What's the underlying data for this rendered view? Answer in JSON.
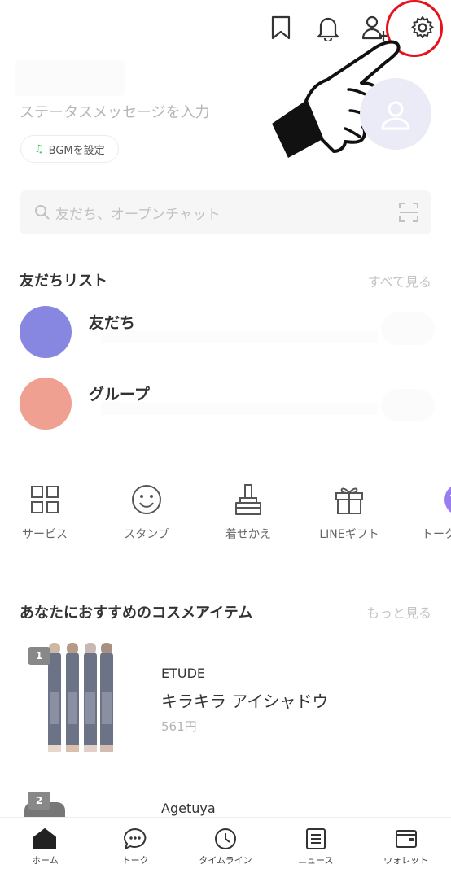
{
  "header": {
    "icons": [
      "bookmark-icon",
      "bell-icon",
      "add-friend-icon",
      "gear-icon"
    ],
    "highlight_color": "#e8101a"
  },
  "profile": {
    "status_placeholder": "ステータスメッセージを入力",
    "bgm_label": "BGMを設定"
  },
  "search": {
    "placeholder": "友だち、オープンチャット"
  },
  "friends_section": {
    "title": "友だちリスト",
    "link": "すべて見る",
    "rows": [
      {
        "label": "友だち",
        "color": "#8786e0"
      },
      {
        "label": "グループ",
        "color": "#f0a090"
      }
    ]
  },
  "services": [
    {
      "label": "サービス",
      "icon": "grid-icon"
    },
    {
      "label": "スタンプ",
      "icon": "smile-icon"
    },
    {
      "label": "着せかえ",
      "icon": "brush-icon"
    },
    {
      "label": "LINEギフト",
      "icon": "gift-icon"
    },
    {
      "label": "トーク",
      "icon": "talk-icon"
    }
  ],
  "recommend_section": {
    "title": "あなたにおすすめのコスメアイテム",
    "link": "もっと見る",
    "items": [
      {
        "rank": "1",
        "brand": "ETUDE",
        "name": "キラキラ アイシャドウ",
        "price": "561円"
      },
      {
        "rank": "2",
        "brand": "Agetuya",
        "name": "",
        "price": ""
      }
    ]
  },
  "bottom_nav": [
    {
      "label": "ホーム",
      "icon": "home-icon"
    },
    {
      "label": "トーク",
      "icon": "chat-icon"
    },
    {
      "label": "タイムライン",
      "icon": "clock-icon"
    },
    {
      "label": "ニュース",
      "icon": "news-icon"
    },
    {
      "label": "ウォレット",
      "icon": "wallet-icon"
    }
  ]
}
